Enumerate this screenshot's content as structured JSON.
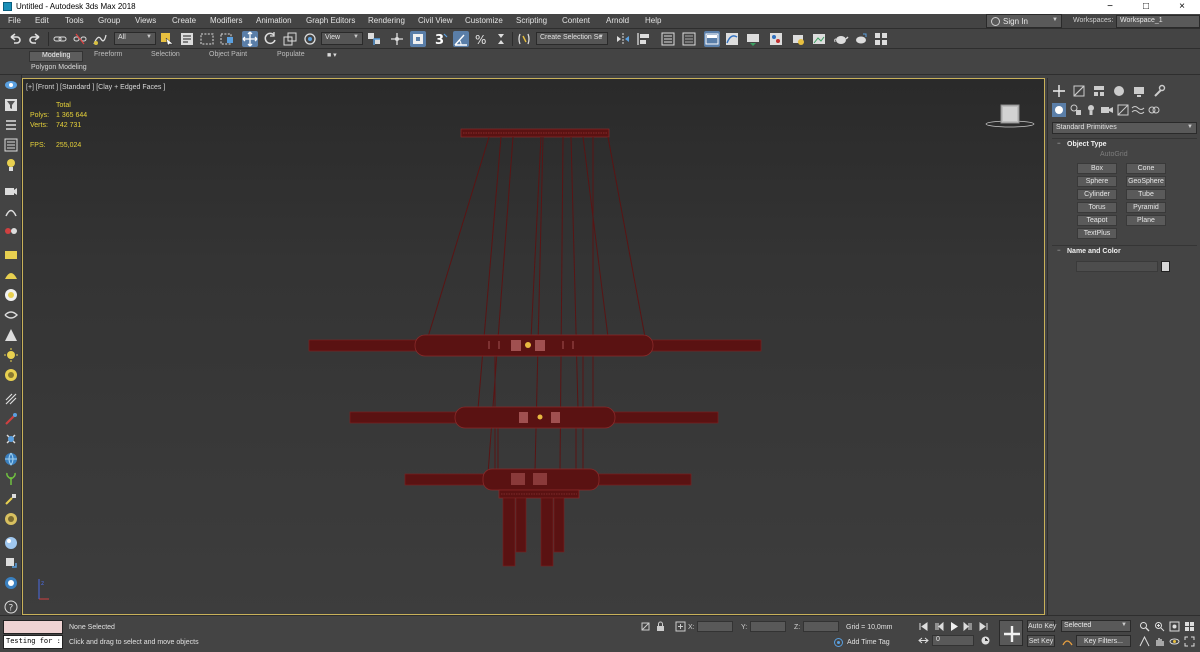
{
  "window": {
    "title": "Untitled - Autodesk 3ds Max 2018",
    "minimize": "−",
    "maximize": "□",
    "close": "×"
  },
  "menu": {
    "items": [
      "File",
      "Edit",
      "Tools",
      "Group",
      "Views",
      "Create",
      "Modifiers",
      "Animation",
      "Graph Editors",
      "Rendering",
      "Civil View",
      "Customize",
      "Scripting",
      "Content",
      "Arnold",
      "Help"
    ],
    "sign_in": "Sign In",
    "workspaces_label": "Workspaces:",
    "workspace_value": "Workspace_1"
  },
  "toolbar": {
    "selection_filter": "All",
    "ref_coord": "View",
    "named_selection": "Create Selection Se",
    "snap_count": "3"
  },
  "ribbon": {
    "tabs": [
      "Modeling",
      "Freeform",
      "Selection",
      "Object Paint",
      "Populate"
    ],
    "active_tab": "Modeling",
    "sub_label": "Polygon Modeling"
  },
  "viewport": {
    "label": "[+] [Front ] [Standard ] [Clay + Edged Faces ]",
    "stats_header": "Total",
    "polys_label": "Polys:",
    "polys_value": "1 365 644",
    "verts_label": "Verts:",
    "verts_value": "742 731",
    "fps_label": "FPS:",
    "fps_value": "255,024",
    "model_color": "#5a1212"
  },
  "command_panel": {
    "category": "Standard Primitives",
    "object_type_title": "Object Type",
    "autogrid": "AutoGrid",
    "buttons": [
      "Box",
      "Cone",
      "Sphere",
      "GeoSphere",
      "Cylinder",
      "Tube",
      "Torus",
      "Pyramid",
      "Teapot",
      "Plane",
      "TextPlus"
    ],
    "name_color_title": "Name and Color",
    "rollout_open": "−"
  },
  "status": {
    "maxscript_text": "Testing for :",
    "selection": "None Selected",
    "prompt": "Click and drag to select and move objects",
    "x_label": "X:",
    "y_label": "Y:",
    "z_label": "Z:",
    "grid": "Grid = 10,0mm",
    "add_time_tag": "Add Time Tag",
    "frame": "0",
    "auto_key": "Auto Key",
    "set_key": "Set Key",
    "selected_mode": "Selected",
    "key_filters": "Key Filters..."
  }
}
